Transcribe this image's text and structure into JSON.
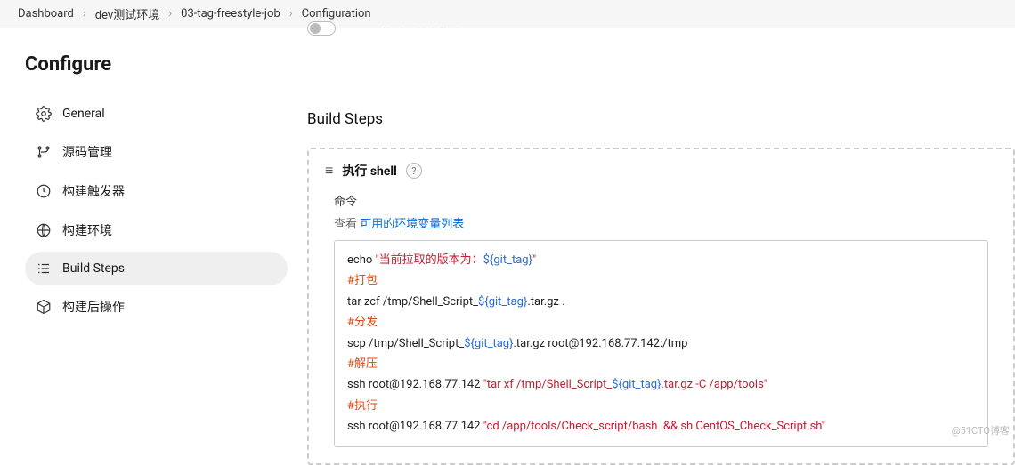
{
  "breadcrumb": {
    "items": [
      "Dashboard",
      "dev测试环境",
      "03-tag-freestyle-job",
      "Configuration"
    ]
  },
  "page_title": "Configure",
  "sidebar": {
    "items": [
      {
        "name": "general",
        "label": "General"
      },
      {
        "name": "source-code",
        "label": "源码管理"
      },
      {
        "name": "build-triggers",
        "label": "构建触发器"
      },
      {
        "name": "build-env",
        "label": "构建环境"
      },
      {
        "name": "build-steps",
        "label": "Build Steps"
      },
      {
        "name": "post-build",
        "label": "构建后操作"
      }
    ]
  },
  "toggle": {
    "label_cut": "在必要的时候并发构建"
  },
  "section": {
    "title": "Build Steps"
  },
  "step": {
    "title": "执行 shell",
    "help": "?",
    "field_label": "命令",
    "hint_prefix": "查看 ",
    "hint_link": "可用的环境变量列表",
    "code": {
      "l1_a": "echo ",
      "l1_b": "\"当前拉取的版本为：",
      "l1_c": "${git_tag}",
      "l1_d": "\"",
      "l2": "#打包",
      "l3_a": "tar zcf /tmp/Shell_Script_",
      "l3_b": "${git_tag}",
      "l3_c": ".tar.gz .",
      "l4": "#分发",
      "l5_a": "scp /tmp/Shell_Script_",
      "l5_b": "${git_tag}",
      "l5_c": ".tar.gz root@192.168.77.142:/tmp",
      "l6": "#解压",
      "l7_a": "ssh root@192.168.77.142 ",
      "l7_b": "\"tar xf /tmp/Shell_Script_",
      "l7_c": "${git_tag}",
      "l7_d": ".tar.gz -C /app/tools\"",
      "l8": "#执行",
      "l9_a": "ssh root@192.168.77.142 ",
      "l9_b": "\"cd /app/tools/Check_script/bash  && sh CentOS_Check_Script.sh\""
    }
  },
  "watermark": "@51CTO博客"
}
